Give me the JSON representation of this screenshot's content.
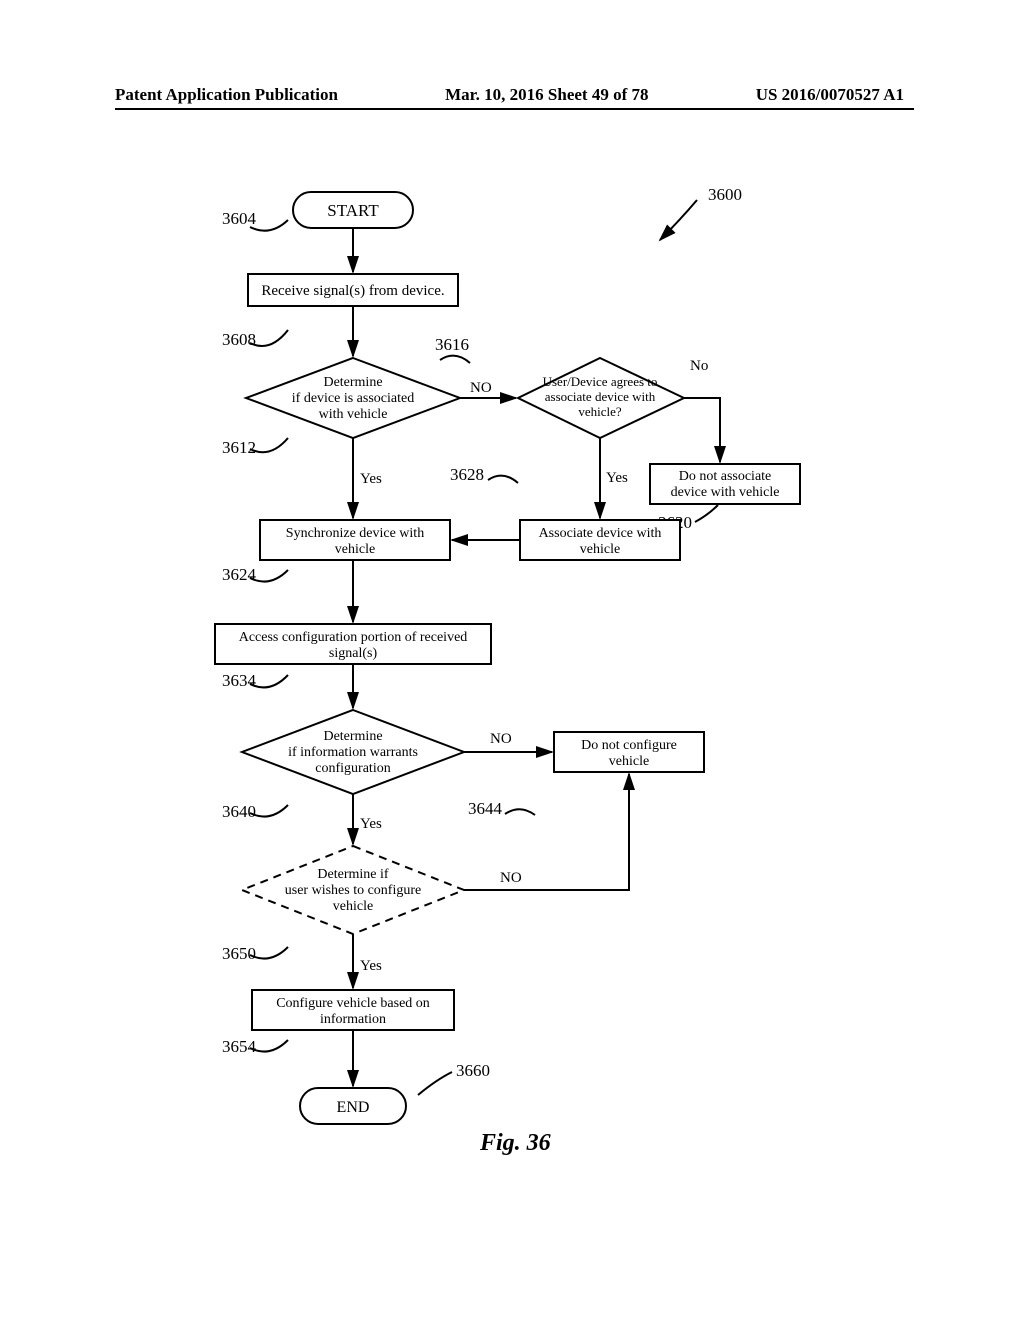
{
  "header": {
    "left": "Patent Application Publication",
    "center": "Mar. 10, 2016  Sheet 49 of 78",
    "right": "US 2016/0070527 A1"
  },
  "labels": {
    "l3600": "3600",
    "l3604": "3604",
    "l3608": "3608",
    "l3612": "3612",
    "l3616": "3616",
    "l3620": "3620",
    "l3624": "3624",
    "l3628": "3628",
    "l3634": "3634",
    "l3640": "3640",
    "l3644": "3644",
    "l3650": "3650",
    "l3654": "3654",
    "l3660": "3660"
  },
  "nodes": {
    "start": "START",
    "end": "END",
    "receive": "Receive signal(s) from device.",
    "det_assoc_l1": "Determine",
    "det_assoc_l2": "if device is associated",
    "det_assoc_l3": "with vehicle",
    "user_agrees_l1": "User/Device agrees to",
    "user_agrees_l2": "associate device with",
    "user_agrees_l3": "vehicle?",
    "do_not_assoc_l1": "Do not associate",
    "do_not_assoc_l2": "device with vehicle",
    "sync_l1": "Synchronize device with",
    "sync_l2": "vehicle",
    "assoc_l1": "Associate device with",
    "assoc_l2": "vehicle",
    "access_l1": "Access configuration portion of received",
    "access_l2": "signal(s)",
    "det_info_l1": "Determine",
    "det_info_l2": "if information warrants",
    "det_info_l3": "configuration",
    "do_not_conf_l1": "Do not configure",
    "do_not_conf_l2": "vehicle",
    "det_user_l1": "Determine if",
    "det_user_l2": "user wishes to configure",
    "det_user_l3": "vehicle",
    "config_l1": "Configure vehicle based on",
    "config_l2": "information"
  },
  "edges": {
    "yes": "Yes",
    "no": "NO",
    "no_cap": "No"
  },
  "figure": "Fig. 36"
}
